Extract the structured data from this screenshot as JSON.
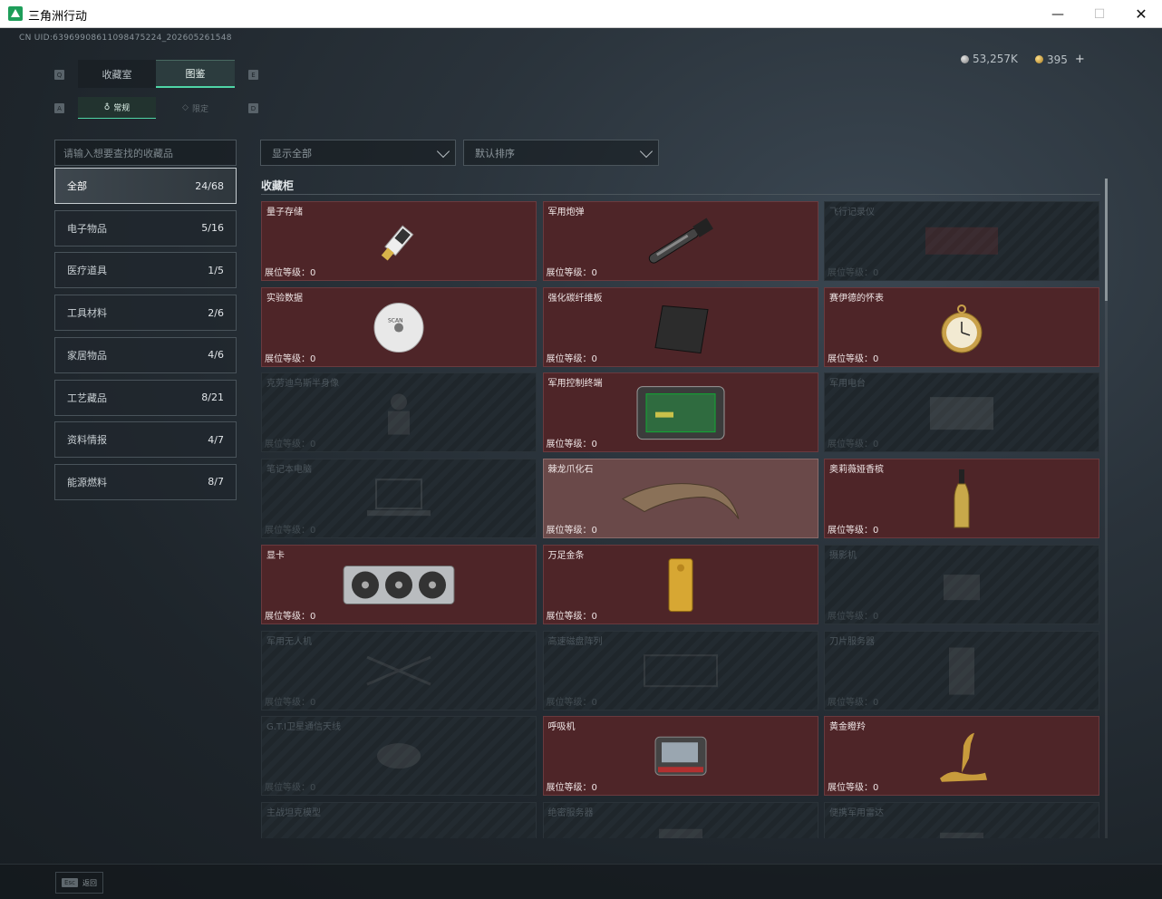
{
  "window": {
    "title": "三角洲行动"
  },
  "header": {
    "uid": "CN UID:63969908611098475224_202605261548",
    "currency": [
      {
        "icon": "silver-coin-icon",
        "value": "53,257K"
      },
      {
        "icon": "gold-coin-icon",
        "value": "395"
      }
    ],
    "plus_label": "+"
  },
  "tabs": [
    {
      "label": "收藏室",
      "active": false
    },
    {
      "label": "图鉴",
      "active": true
    }
  ],
  "subtabs": [
    {
      "label": "常规",
      "active": true
    },
    {
      "label": "限定",
      "active": false
    }
  ],
  "key_hints": {
    "left_tab": "Q",
    "right_tab": "E",
    "left_sub": "A",
    "right_sub": "D"
  },
  "search": {
    "placeholder": "请输入想要查找的收藏品"
  },
  "filters": [
    {
      "value": "显示全部"
    },
    {
      "value": "默认排序"
    }
  ],
  "categories": [
    {
      "label": "全部",
      "count": "24/68",
      "active": true
    },
    {
      "label": "电子物品",
      "count": "5/16"
    },
    {
      "label": "医疗道具",
      "count": "1/5"
    },
    {
      "label": "工具材料",
      "count": "2/6"
    },
    {
      "label": "家居物品",
      "count": "4/6"
    },
    {
      "label": "工艺藏品",
      "count": "8/21"
    },
    {
      "label": "资料情报",
      "count": "4/7"
    },
    {
      "label": "能源燃料",
      "count": "8/7"
    }
  ],
  "section_title": "收藏柜",
  "level_label": "展位等级：",
  "items": [
    {
      "name": "量子存储",
      "level": "0",
      "state": "owned",
      "icon": "usb-drive-icon"
    },
    {
      "name": "军用炮弹",
      "level": "0",
      "state": "owned",
      "icon": "artillery-shell-icon"
    },
    {
      "name": "飞行记录仪",
      "level": "0",
      "state": "locked",
      "icon": "flight-recorder-icon"
    },
    {
      "name": "实验数据",
      "level": "0",
      "state": "owned",
      "icon": "disc-icon"
    },
    {
      "name": "强化碳纤维板",
      "level": "0",
      "state": "owned",
      "icon": "carbon-plate-icon"
    },
    {
      "name": "赛伊德的怀表",
      "level": "0",
      "state": "owned",
      "icon": "pocket-watch-icon"
    },
    {
      "name": "克劳迪乌斯半身像",
      "level": "0",
      "state": "locked",
      "icon": "bust-icon"
    },
    {
      "name": "军用控制终端",
      "level": "0",
      "state": "owned",
      "icon": "control-terminal-icon"
    },
    {
      "name": "军用电台",
      "level": "0",
      "state": "locked",
      "icon": "radio-icon"
    },
    {
      "name": "笔记本电脑",
      "level": "0",
      "state": "locked",
      "icon": "laptop-icon"
    },
    {
      "name": "棘龙爪化石",
      "level": "0",
      "state": "highlight",
      "icon": "claw-fossil-icon"
    },
    {
      "name": "奥莉薇娅香槟",
      "level": "0",
      "state": "owned",
      "icon": "champagne-icon"
    },
    {
      "name": "显卡",
      "level": "0",
      "state": "owned",
      "icon": "graphics-card-icon"
    },
    {
      "name": "万足金条",
      "level": "0",
      "state": "owned",
      "icon": "gold-bar-icon"
    },
    {
      "name": "摄影机",
      "level": "0",
      "state": "locked",
      "icon": "camera-icon"
    },
    {
      "name": "军用无人机",
      "level": "0",
      "state": "locked",
      "icon": "drone-icon"
    },
    {
      "name": "高速磁盘阵列",
      "level": "0",
      "state": "locked",
      "icon": "disk-array-icon"
    },
    {
      "name": "刀片服务器",
      "level": "0",
      "state": "locked",
      "icon": "blade-server-icon"
    },
    {
      "name": "G.T.I卫星通信天线",
      "level": "0",
      "state": "locked",
      "icon": "satellite-dish-icon"
    },
    {
      "name": "呼吸机",
      "level": "0",
      "state": "owned",
      "icon": "ventilator-icon"
    },
    {
      "name": "黄金瞪羚",
      "level": "0",
      "state": "owned",
      "icon": "gold-gazelle-icon"
    },
    {
      "name": "主战坦克模型",
      "level": "",
      "state": "locked",
      "icon": "tank-model-icon"
    },
    {
      "name": "绝密服务器",
      "level": "",
      "state": "locked",
      "icon": "server-icon"
    },
    {
      "name": "便携军用雷达",
      "level": "",
      "state": "locked",
      "icon": "radar-icon"
    }
  ],
  "footer": {
    "esc_key": "Esc",
    "back_label": "返回"
  },
  "colors": {
    "accent": "#4fd5a6",
    "owned_card": "#4e2528",
    "highlight_card": "#6a4949",
    "locked_card": "#1f262b"
  }
}
